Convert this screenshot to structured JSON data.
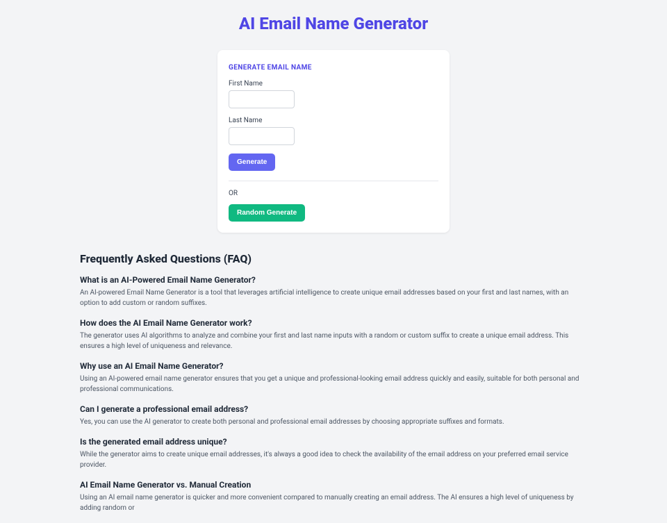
{
  "title": "AI Email Name Generator",
  "card": {
    "heading": "GENERATE EMAIL NAME",
    "first_name_label": "First Name",
    "last_name_label": "Last Name",
    "generate_label": "Generate",
    "or_label": "OR",
    "random_generate_label": "Random Generate"
  },
  "faq": {
    "title": "Frequently Asked Questions (FAQ)",
    "items": [
      {
        "q": "What is an AI-Powered Email Name Generator?",
        "a": "An AI-powered Email Name Generator is a tool that leverages artificial intelligence to create unique email addresses based on your first and last names, with an option to add custom or random suffixes."
      },
      {
        "q": "How does the AI Email Name Generator work?",
        "a": "The generator uses AI algorithms to analyze and combine your first and last name inputs with a random or custom suffix to create a unique email address. This ensures a high level of uniqueness and relevance."
      },
      {
        "q": "Why use an AI Email Name Generator?",
        "a": "Using an AI-powered email name generator ensures that you get a unique and professional-looking email address quickly and easily, suitable for both personal and professional communications."
      },
      {
        "q": "Can I generate a professional email address?",
        "a": "Yes, you can use the AI generator to create both personal and professional email addresses by choosing appropriate suffixes and formats."
      },
      {
        "q": "Is the generated email address unique?",
        "a": "While the generator aims to create unique email addresses, it's always a good idea to check the availability of the email address on your preferred email service provider."
      },
      {
        "q": "AI Email Name Generator vs. Manual Creation",
        "a": "Using an AI email name generator is quicker and more convenient compared to manually creating an email address. The AI ensures a high level of uniqueness by adding random or"
      }
    ]
  }
}
